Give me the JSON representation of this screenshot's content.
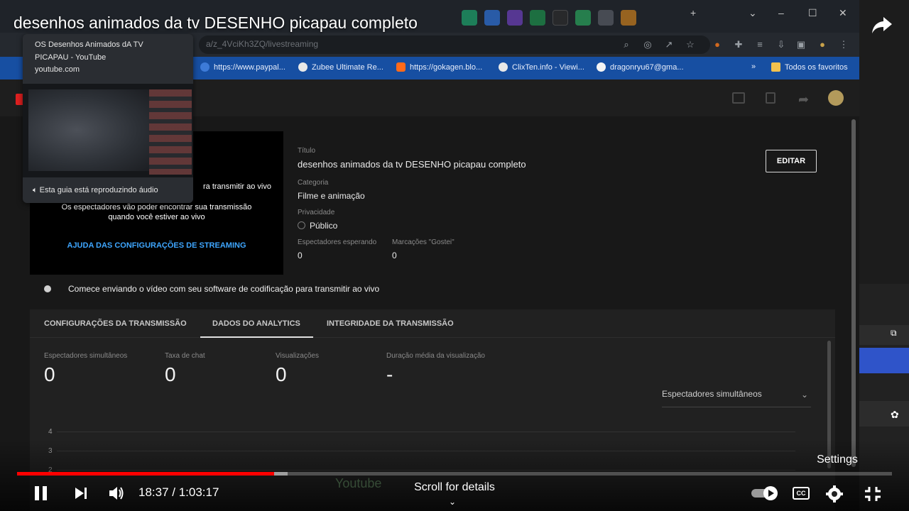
{
  "player": {
    "title": "desenhos animados da tv DESENHO picapau completo",
    "current_time": "18:37",
    "duration": "1:03:17",
    "time_display": "18:37 / 1:03:17",
    "progress_fraction": 0.294,
    "buffered_fraction": 0.309,
    "scroll_hint": "Scroll for details",
    "settings_tooltip": "Settings",
    "cc_label": "CC",
    "accent_color": "#ff0000"
  },
  "browser": {
    "url_partial": "a/z_4VciKh3ZQ/livestreaming",
    "bookmarks": [
      {
        "label": "https://www.paypal..."
      },
      {
        "label": "Zubee Ultimate Re..."
      },
      {
        "label": "https://gokagen.blo..."
      },
      {
        "label": "ClixTen.info - Viewi..."
      },
      {
        "label": "dragonryu67@gma..."
      }
    ],
    "bookmarks_more": "»",
    "all_favorites": "Todos os favoritos",
    "bookmark_bar_color": "#174fa2"
  },
  "hovercard": {
    "title": "OS Desenhos Animados dA TV PICAPAU - YouTube",
    "domain": "youtube.com",
    "audio_note": "Esta guia está reproduzindo áudio"
  },
  "preview": {
    "line1": "ra transmitir ao vivo",
    "line2": "Os espectadores vão poder encontrar sua transmissão",
    "line3": "quando você estiver ao vivo",
    "help_link": "AJUDA DAS CONFIGURAÇÕES DE STREAMING"
  },
  "details": {
    "title_label": "Título",
    "title_value": "desenhos animados da tv DESENHO picapau completo",
    "category_label": "Categoria",
    "category_value": "Filme e animação",
    "privacy_label": "Privacidade",
    "privacy_value": "Público",
    "waiting_label": "Espectadores esperando",
    "waiting_value": "0",
    "likes_label": "Marcações \"Gostei\"",
    "likes_value": "0",
    "edit_button": "EDITAR"
  },
  "status": {
    "message": "Comece enviando o vídeo com seu software de codificação para transmitir ao vivo"
  },
  "tabs": [
    {
      "label": "CONFIGURAÇÕES DA TRANSMISSÃO"
    },
    {
      "label": "DADOS DO ANALYTICS"
    },
    {
      "label": "INTEGRIDADE DA TRANSMISSÃO"
    }
  ],
  "metrics": [
    {
      "label": "Espectadores simultâneos",
      "value": "0"
    },
    {
      "label": "Taxa de chat",
      "value": "0"
    },
    {
      "label": "Visualizações",
      "value": "0"
    },
    {
      "label": "Duração média da visualização",
      "value": "-"
    }
  ],
  "chart_select": {
    "value": "Espectadores simultâneos"
  },
  "y_ticks": [
    "4",
    "3",
    "2"
  ]
}
